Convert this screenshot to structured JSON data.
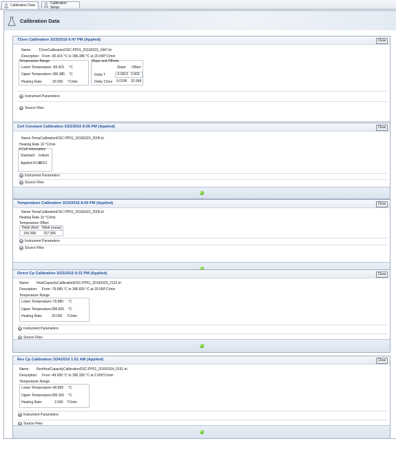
{
  "tabs": [
    {
      "label": "Calibration Data",
      "active": true
    },
    {
      "label": "Calibration Setup",
      "active": false
    }
  ],
  "header": {
    "title": "Calibration Data"
  },
  "common": {
    "clear_label": "Clear",
    "instrument_parameters": "Instrument Parameters",
    "source_files": "Source Files"
  },
  "tzero": {
    "title": "TZero Calibration   3/23/2016 6:47 PM   (Applied)",
    "name_label": "Name:",
    "name_value": "TZeroCalibrationDSC-PP01_20160323_1847.tri",
    "desc_label": "Description:",
    "desc_value": "From -90.415 °C to 396.385 °C at 20.000°C/min",
    "temp_range_title": "Temperature Range",
    "lower_label": "Lower Temperature:",
    "lower_value": "-90.415",
    "lower_unit": "°C",
    "upper_label": "Upper Temperature:",
    "upper_value": "396.385",
    "upper_unit": "°C",
    "rate_label": "Heating Rate:",
    "rate_value": "20.000",
    "rate_unit": "°C/min",
    "slope_title": "Slope and Offsets",
    "slope_header": "Slope",
    "offset_header": "Offset",
    "delta_t_label": "Delta T",
    "delta_t_slope": "-0.0013",
    "delta_t_offset": "2.903",
    "delta_tzero_label": "Delta TZero",
    "delta_tzero_slope": "0.0198",
    "delta_tzero_offset": "32.968"
  },
  "cell": {
    "title": "Cell Constant Calibration   3/23/2016 8:06 PM   (Applied)",
    "name_label": "Name:",
    "name_value": "TempCalibrationDSC-PP01_20160323_2005.tri",
    "heating_rate": "Heating Rate  10  °C/min",
    "kcell_title": "KCell Information",
    "standard_label": "Standard",
    "standard_value": "Indium",
    "applied_label": "Applied KCell",
    "applied_value": "1.021"
  },
  "temperature": {
    "title": "Temperature Calibration   3/23/2016 8:05 PM   (Applied)",
    "name_label": "Name:",
    "name_value": "TempCalibrationDSC-PP01_20160323_2005.tri",
    "heating_rate": "Heating Rate  10  °C/min",
    "offset_title": "Temperature Offset",
    "tmelt_ref_header": "TMelt (Ref)",
    "tmelt_meas_header": "TMelt (meas)",
    "tmelt_ref_value": "156.598",
    "tmelt_meas_value": "157.956"
  },
  "directcp": {
    "title": "Direct Cp Calibration   3/23/2016 9:22 PM   (Applied)",
    "name_label": "Name:",
    "name_value": "HeatCapacityCalibrationDSC-PP01_20160323_2122.tri",
    "desc_label": "Description:",
    "desc_value": "From -79.980 °C to 396.826 °C at 20.000°C/min",
    "temp_range_title": "Temperature Range",
    "lower_label": "Lower Temperature:",
    "lower_value": "-79.980",
    "lower_unit": "°C",
    "upper_label": "Upper Temperature:",
    "upper_value": "396.826",
    "upper_unit": "°C",
    "rate_label": "Heating Rate:",
    "rate_value": "20.000",
    "rate_unit": "°C/min"
  },
  "revcp": {
    "title": "Rev Cp Calibration   3/24/2016 1:51 AM   (Applied)",
    "name_label": "Name:",
    "name_value": "RevHeatCapacityCalibrationDSC-PP01_20160324_0151.tri",
    "desc_label": "Description:",
    "desc_value": "From -49.999 °C to 395.326 °C at 2.000°C/min",
    "temp_range_title": "Temperature Range",
    "lower_label": "Lower Temperature:",
    "lower_value": "-49.999",
    "lower_unit": "°C",
    "upper_label": "Upper Temperature:",
    "upper_value": "395.326",
    "upper_unit": "°C",
    "rate_label": "Heating Rate:",
    "rate_value": "2.000",
    "rate_unit": "°C/min"
  },
  "colors": {
    "title_blue": "#1f4e9c",
    "status_green": "#5cc21d"
  },
  "icons": [
    "calibration-icon",
    "chevron-down-icon",
    "status-led-icon"
  ]
}
